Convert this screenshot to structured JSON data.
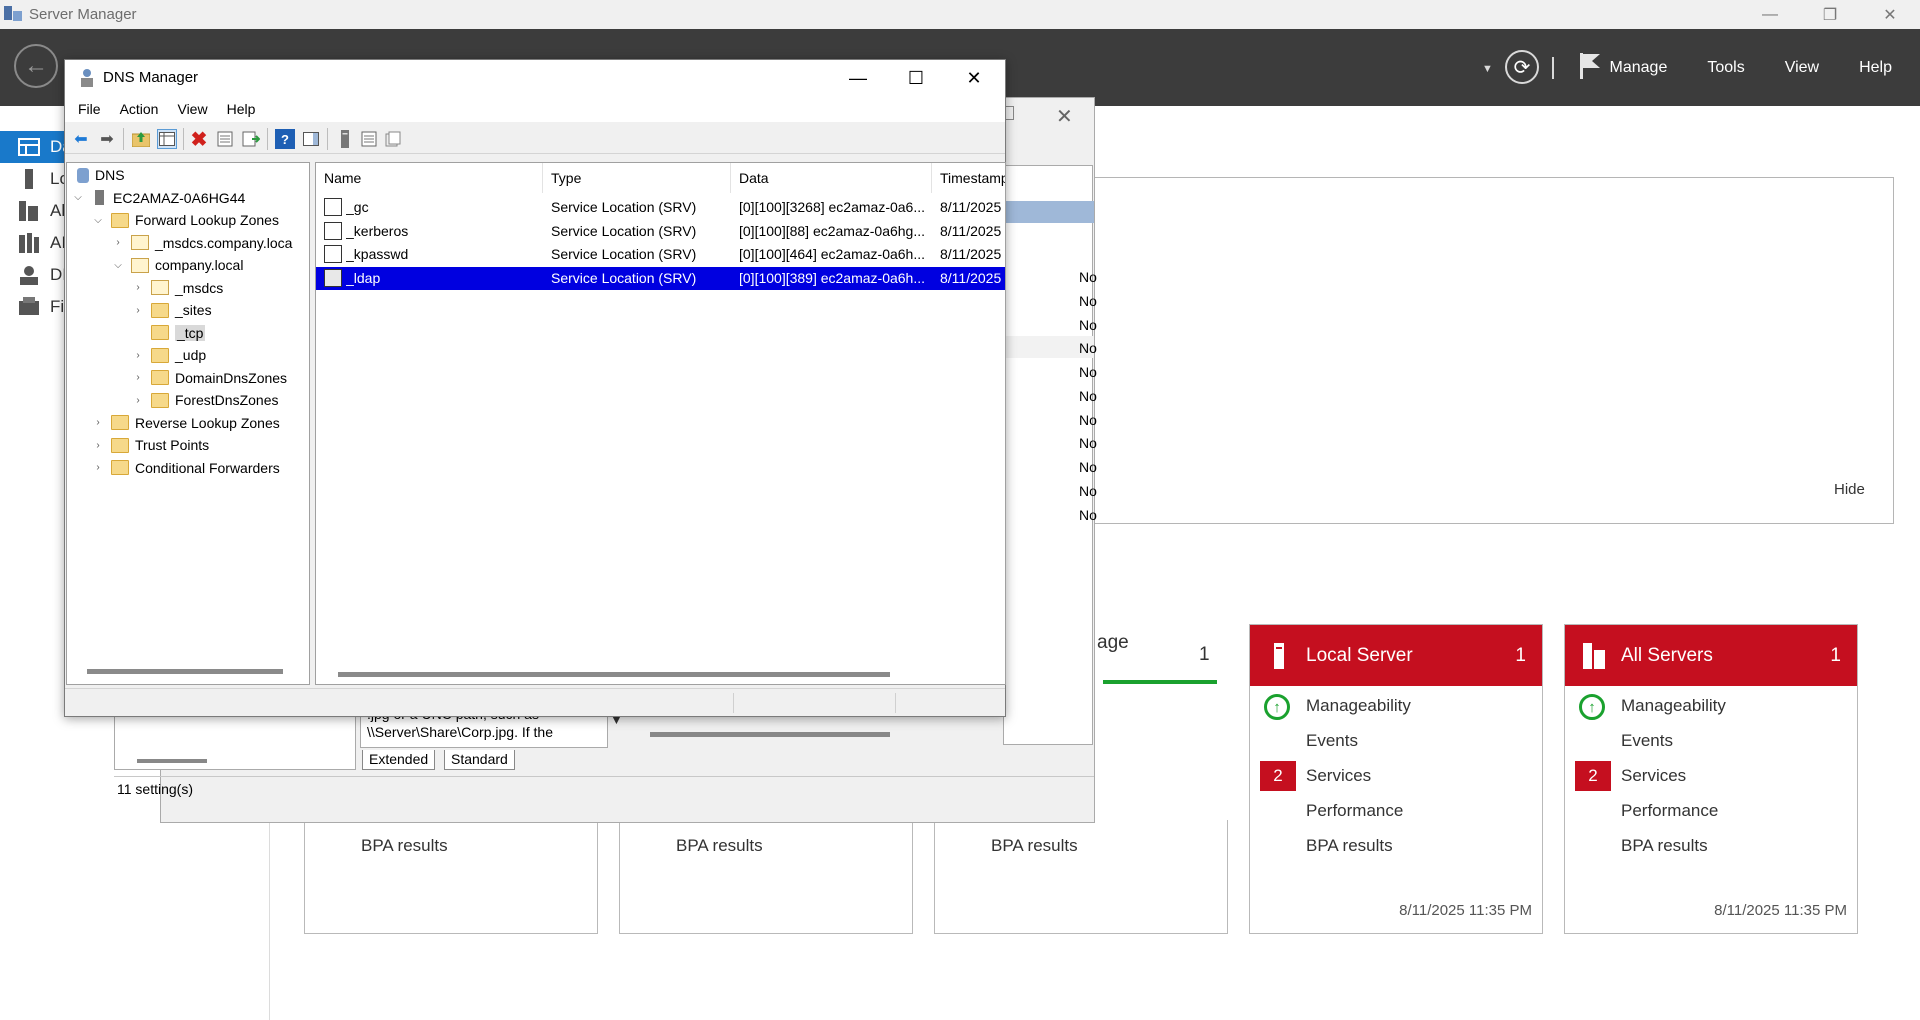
{
  "server_manager": {
    "title": "Server Manager",
    "window_controls": {
      "minimize": "—",
      "restore": "❐",
      "close": "✕"
    },
    "header": {
      "back_glyph": "←",
      "menus": [
        "Manage",
        "Tools",
        "View",
        "Help"
      ],
      "refresh_glyph": "⟳",
      "dropdown_glyph": "▼"
    },
    "nav": [
      {
        "label": "Da",
        "icon": "dashboard-icon",
        "active": true
      },
      {
        "label": "Lo",
        "icon": "local-server-icon"
      },
      {
        "label": "Al",
        "icon": "all-servers-icon"
      },
      {
        "label": "AI",
        "icon": "ad-ds-icon"
      },
      {
        "label": "DI",
        "icon": "dns-icon"
      },
      {
        "label": "Fi",
        "icon": "file-storage-icon"
      }
    ],
    "hide_label": "Hide",
    "tiles": [
      {
        "title": "Local Server",
        "count": "1",
        "rows": {
          "manageability": "Manageability",
          "events": "Events",
          "services": "Services",
          "services_badge": "2",
          "performance": "Performance",
          "bpa": "BPA results"
        },
        "timestamp": "8/11/2025 11:35 PM"
      },
      {
        "title": "All Servers",
        "count": "1",
        "rows": {
          "manageability": "Manageability",
          "events": "Events",
          "services": "Services",
          "services_badge": "2",
          "performance": "Performance",
          "bpa": "BPA results"
        },
        "timestamp": "8/11/2025 11:35 PM"
      }
    ],
    "partial_tiles": [
      {
        "bpa": "BPA results"
      },
      {
        "bpa": "BPA results"
      },
      {
        "bpa": "BPA results"
      }
    ],
    "partial_tile_title": "age",
    "partial_tile_count": "1"
  },
  "bg_dialog": {
    "close_glyph": "✕",
    "no_values": [
      "No",
      "No",
      "No",
      "No",
      "No",
      "No",
      "No",
      "No",
      "No",
      "No",
      "No"
    ],
    "description_text": ".jpg or a UNC path, such as \\\\Server\\Share\\Corp.jpg. If the",
    "tabs": [
      "Extended",
      "Standard"
    ],
    "status": "11 setting(s)"
  },
  "dns_manager": {
    "title": "DNS Manager",
    "window_controls": {
      "minimize": "—",
      "maximize": "☐",
      "close": "✕"
    },
    "menus": [
      "File",
      "Action",
      "View",
      "Help"
    ],
    "tree": [
      {
        "label": "DNS",
        "icon": "dns-root-icon"
      },
      {
        "label": "EC2AMAZ-0A6HG44",
        "icon": "server-icon",
        "exp": "v"
      },
      {
        "label": "Forward Lookup Zones",
        "icon": "folder-icon",
        "exp": "v"
      },
      {
        "label": "_msdcs.company.loca",
        "icon": "zone-icon",
        "exp": ">"
      },
      {
        "label": "company.local",
        "icon": "zone-icon",
        "exp": "v"
      },
      {
        "label": "_msdcs",
        "icon": "delegation-icon",
        "exp": ">"
      },
      {
        "label": "_sites",
        "icon": "folder-icon",
        "exp": ">"
      },
      {
        "label": "_tcp",
        "icon": "folder-icon",
        "exp": "",
        "selected": true
      },
      {
        "label": "_udp",
        "icon": "folder-icon",
        "exp": ">"
      },
      {
        "label": "DomainDnsZones",
        "icon": "folder-icon",
        "exp": ">"
      },
      {
        "label": "ForestDnsZones",
        "icon": "folder-icon",
        "exp": ">"
      },
      {
        "label": "Reverse Lookup Zones",
        "icon": "folder-icon",
        "exp": ">"
      },
      {
        "label": "Trust Points",
        "icon": "folder-icon",
        "exp": ">"
      },
      {
        "label": "Conditional Forwarders",
        "icon": "folder-icon",
        "exp": ">"
      }
    ],
    "columns": [
      "Name",
      "Type",
      "Data",
      "Timestamp"
    ],
    "records": [
      {
        "name": "_gc",
        "type": "Service Location (SRV)",
        "data": "[0][100][3268] ec2amaz-0a6...",
        "timestamp": "8/11/2025"
      },
      {
        "name": "_kerberos",
        "type": "Service Location (SRV)",
        "data": "[0][100][88] ec2amaz-0a6hg...",
        "timestamp": "8/11/2025"
      },
      {
        "name": "_kpasswd",
        "type": "Service Location (SRV)",
        "data": "[0][100][464] ec2amaz-0a6h...",
        "timestamp": "8/11/2025"
      },
      {
        "name": "_ldap",
        "type": "Service Location (SRV)",
        "data": "[0][100][389] ec2amaz-0a6h...",
        "timestamp": "8/11/2025",
        "selected": true
      }
    ]
  }
}
